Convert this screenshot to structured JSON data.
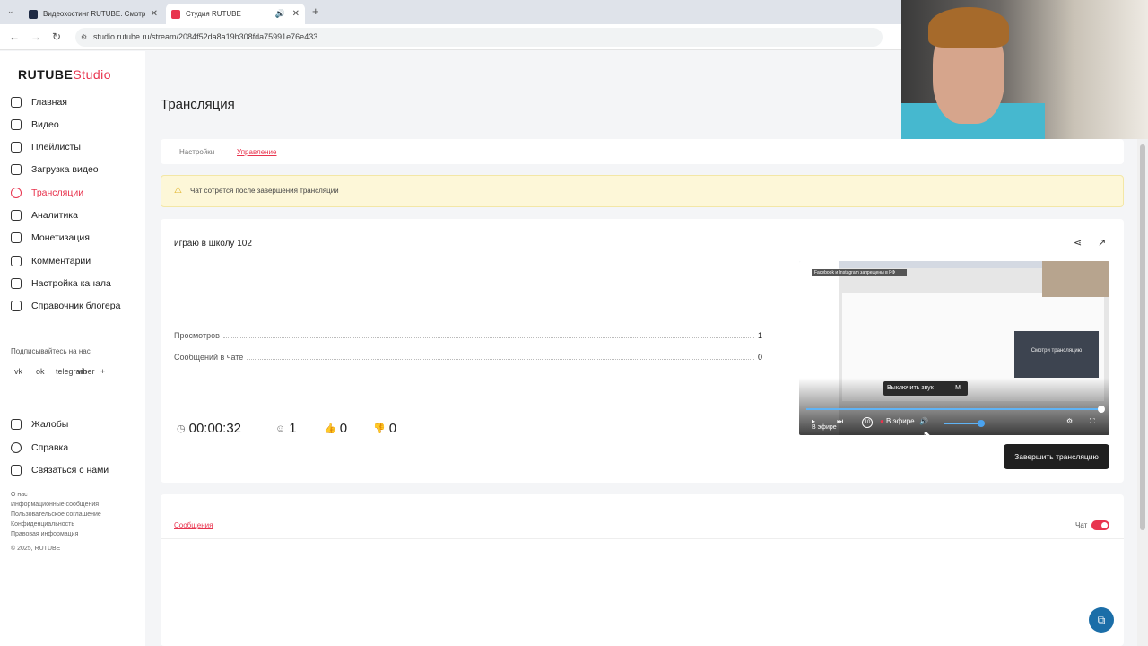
{
  "browser": {
    "tabs": [
      {
        "title": "Видеохостинг RUTUBE. Смотр",
        "active": false
      },
      {
        "title": "Студия RUTUBE",
        "active": true
      }
    ],
    "new_tab": "+",
    "url": "studio.rutube.ru/stream/2084f52da8a19b308fda75991e76e433"
  },
  "sidebar": {
    "logo_main": "RUTUBE",
    "logo_sub": "Studio",
    "nav": [
      {
        "label": "Главная",
        "icon": "home-icon"
      },
      {
        "label": "Видео",
        "icon": "video-icon"
      },
      {
        "label": "Плейлисты",
        "icon": "playlist-icon"
      },
      {
        "label": "Загрузка видео",
        "icon": "upload-icon"
      },
      {
        "label": "Трансляции",
        "icon": "broadcast-icon",
        "active": true
      },
      {
        "label": "Аналитика",
        "icon": "analytics-icon"
      },
      {
        "label": "Монетизация",
        "icon": "monetization-icon"
      },
      {
        "label": "Комментарии",
        "icon": "comments-icon"
      },
      {
        "label": "Настройка канала",
        "icon": "settings-icon"
      },
      {
        "label": "Справочник блогера",
        "icon": "handbook-icon"
      }
    ],
    "subscribe_label": "Подписывайтесь на нас",
    "social": [
      "vk",
      "ok",
      "telegram",
      "viber",
      "+"
    ],
    "help_nav": [
      {
        "label": "Жалобы",
        "icon": "flag-icon"
      },
      {
        "label": "Справка",
        "icon": "help-icon"
      },
      {
        "label": "Связаться с нами",
        "icon": "mail-icon"
      }
    ],
    "footer_links": [
      "О нас",
      "Информационные сообщения",
      "Пользовательское соглашение",
      "Конфиденциальность",
      "Правовая информация",
      "© 2025, RUTUBE"
    ]
  },
  "page": {
    "title": "Трансляция",
    "tabs": [
      "Настройки",
      "Управление"
    ],
    "active_tab": "Управление",
    "warning": "Чат сотрётся после завершения трансляции"
  },
  "stream": {
    "title": "играю в школу 102",
    "stats": [
      {
        "label": "Просмотров",
        "value": "1"
      },
      {
        "label": "Сообщений в чате",
        "value": "0"
      }
    ],
    "duration": "00:00:32",
    "viewers": "1",
    "likes": "0",
    "dislikes": "0",
    "end_button": "Завершить трансляцию",
    "preview": {
      "top_chip": "Facebook и Instagram запрещены в РФ",
      "panel_text": "Смотри трансляцию",
      "tooltip": "Выключить звук",
      "tooltip_key": "M",
      "live_label": "В эфире",
      "live_label_2": "В эфире",
      "rewind": "10",
      "volume": 0.75
    }
  },
  "messages": {
    "tab_label": "Сообщения",
    "chat_label": "Чат",
    "chat_enabled": true
  },
  "colors": {
    "accent": "#e8344e",
    "warning_bg": "#fdf7d8",
    "button_dark": "#1f1f1f"
  }
}
